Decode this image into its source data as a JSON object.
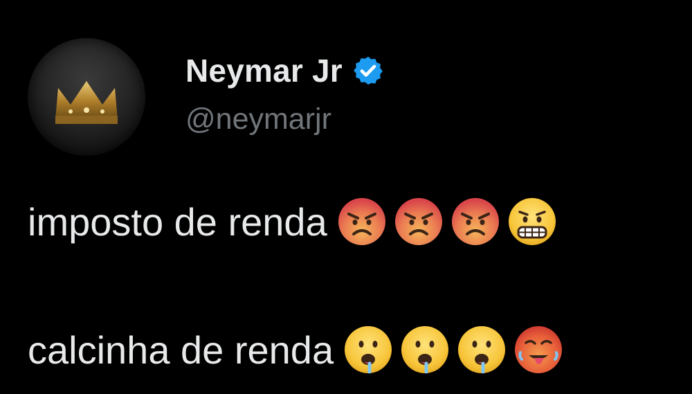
{
  "tweet": {
    "author": {
      "display_name": "Neymar Jr",
      "handle": "@neymarjr",
      "verified_icon": "verified-badge-icon",
      "avatar_icon": "crown-icon"
    },
    "lines": [
      {
        "text": "imposto de renda",
        "emojis": [
          "angry-face-icon",
          "angry-face-icon",
          "angry-face-icon",
          "grimacing-face-icon"
        ]
      },
      {
        "text": "calcinha de renda",
        "emojis": [
          "drooling-face-icon",
          "drooling-face-icon",
          "drooling-face-icon",
          "hot-face-icon"
        ]
      }
    ]
  },
  "colors": {
    "background": "#000000",
    "text_primary": "#e7e9ea",
    "text_secondary": "#71767b",
    "verified_blue": "#1d9bf0"
  }
}
